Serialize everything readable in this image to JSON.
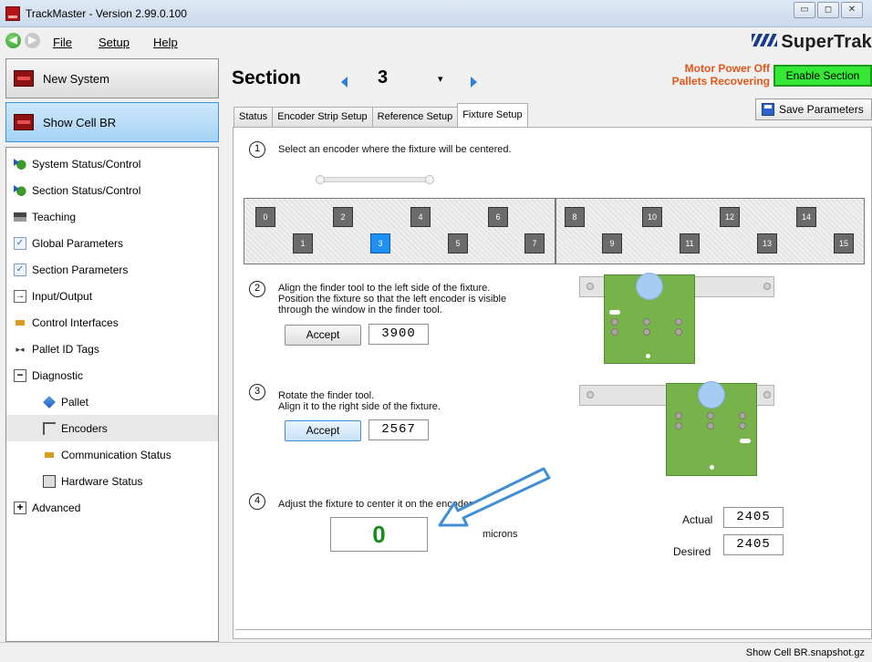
{
  "window": {
    "title": "TrackMaster - Version 2.99.0.100"
  },
  "window_buttons": {
    "minimize": "▭",
    "maximize": "◻",
    "close": "✕"
  },
  "menu": {
    "file": "File",
    "setup": "Setup",
    "help": "Help"
  },
  "brand": {
    "logo_text": "SuperTrak",
    "logo_color": "#1b3c8c"
  },
  "left_panel": {
    "new_system": "New System",
    "show_cell": "Show Cell BR",
    "nav_items": [
      {
        "label": "System Status/Control",
        "icon": "status-control-icon"
      },
      {
        "label": "Section Status/Control",
        "icon": "status-control-icon"
      },
      {
        "label": "Teaching",
        "icon": "teaching-icon"
      },
      {
        "label": "Global Parameters",
        "icon": "parameters-icon"
      },
      {
        "label": "Section Parameters",
        "icon": "parameters-icon"
      },
      {
        "label": "Input/Output",
        "icon": "input-output-icon"
      },
      {
        "label": "Control Interfaces",
        "icon": "plug-icon"
      },
      {
        "label": "Pallet ID Tags",
        "icon": "tag-icon"
      },
      {
        "label": "Diagnostic",
        "icon": "collapse-icon"
      },
      {
        "label": "Pallet",
        "icon": "pallet-icon"
      },
      {
        "label": "Encoders",
        "icon": "encoder-icon"
      },
      {
        "label": "Communication Status",
        "icon": "plug-icon"
      },
      {
        "label": "Hardware Status",
        "icon": "hardware-icon"
      },
      {
        "label": "Advanced",
        "icon": "expand-icon"
      }
    ]
  },
  "section": {
    "title": "Section",
    "number": "3",
    "motor_status_line1": "Motor Power Off",
    "motor_status_line2": "Pallets Recovering",
    "enable_label": "Enable Section",
    "status_color": "#e0571a",
    "enable_color": "#35e835"
  },
  "tabs": [
    {
      "label": "Status",
      "active": false
    },
    {
      "label": "Encoder Strip Setup",
      "active": false
    },
    {
      "label": "Reference Setup",
      "active": false
    },
    {
      "label": "Fixture Setup",
      "active": true
    }
  ],
  "save_parameters": "Save Parameters",
  "steps": {
    "step1": {
      "num": "1",
      "text": "Select an encoder where the fixture will be centered."
    },
    "step2": {
      "num": "2",
      "line1": "Align the finder tool to the left side of the fixture.",
      "line2": "Position the fixture so that the left encoder is visible",
      "line3": "through the window in the finder tool.",
      "accept": "Accept",
      "value": "3900"
    },
    "step3": {
      "num": "3",
      "line1": "Rotate the finder tool.",
      "line2": "Align it to the right side of the fixture.",
      "accept": "Accept",
      "value": "2567"
    },
    "step4": {
      "num": "4",
      "text": "Adjust the fixture to center it on the encoder.",
      "result": "0",
      "unit": "microns",
      "actual_label": "Actual",
      "actual_value": "2405",
      "desired_label": "Desired",
      "desired_value": "2405"
    }
  },
  "encoders": {
    "top_row": [
      "0",
      "2",
      "4",
      "6",
      "8",
      "10",
      "12",
      "14"
    ],
    "bottom_row": [
      "1",
      "3",
      "5",
      "7",
      "9",
      "11",
      "13",
      "15"
    ],
    "selected": "3",
    "selected_color": "#1f8ff3"
  },
  "status_bar": {
    "text": "Show Cell BR.snapshot.gz"
  }
}
